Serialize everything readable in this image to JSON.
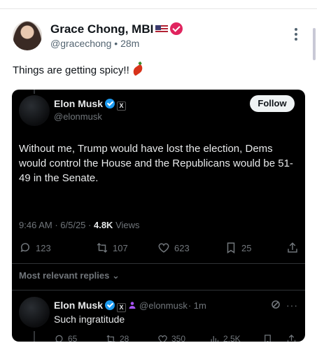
{
  "post": {
    "author_name": "Grace Chong, MBI",
    "author_handle": "@gracechong",
    "time": "28m",
    "text": "Things are getting spicy!!",
    "icons": [
      "flag-us-icon",
      "verified-pink-icon",
      "more-vertical-icon",
      "chili-pepper-icon"
    ]
  },
  "quote": {
    "author_name": "Elon Musk",
    "author_handle": "@elonmusk",
    "follow_label": "Follow",
    "body": "Without me, Trump would have lost the election, Dems would control the House and the Republicans would be 51-49 in the Senate.",
    "time": "9:46 AM",
    "date": "6/5/25",
    "views_count": "4.8K",
    "views_label": "Views",
    "stats": {
      "replies": "123",
      "reposts": "107",
      "likes": "623",
      "bookmarks": "25"
    },
    "replies_filter_label": "Most relevant replies",
    "x_badge": "X"
  },
  "reply": {
    "author_name": "Elon Musk",
    "author_handle": "@elonmusk",
    "time": "· 1m",
    "text": "Such ingratitude",
    "stats": {
      "replies": "65",
      "reposts": "28",
      "likes": "350",
      "views": "2.5K"
    }
  },
  "colors": {
    "accent_blue": "#1d9bf0",
    "verified_pink": "#e0245e",
    "card_bg": "#000000",
    "muted": "#71767b"
  }
}
